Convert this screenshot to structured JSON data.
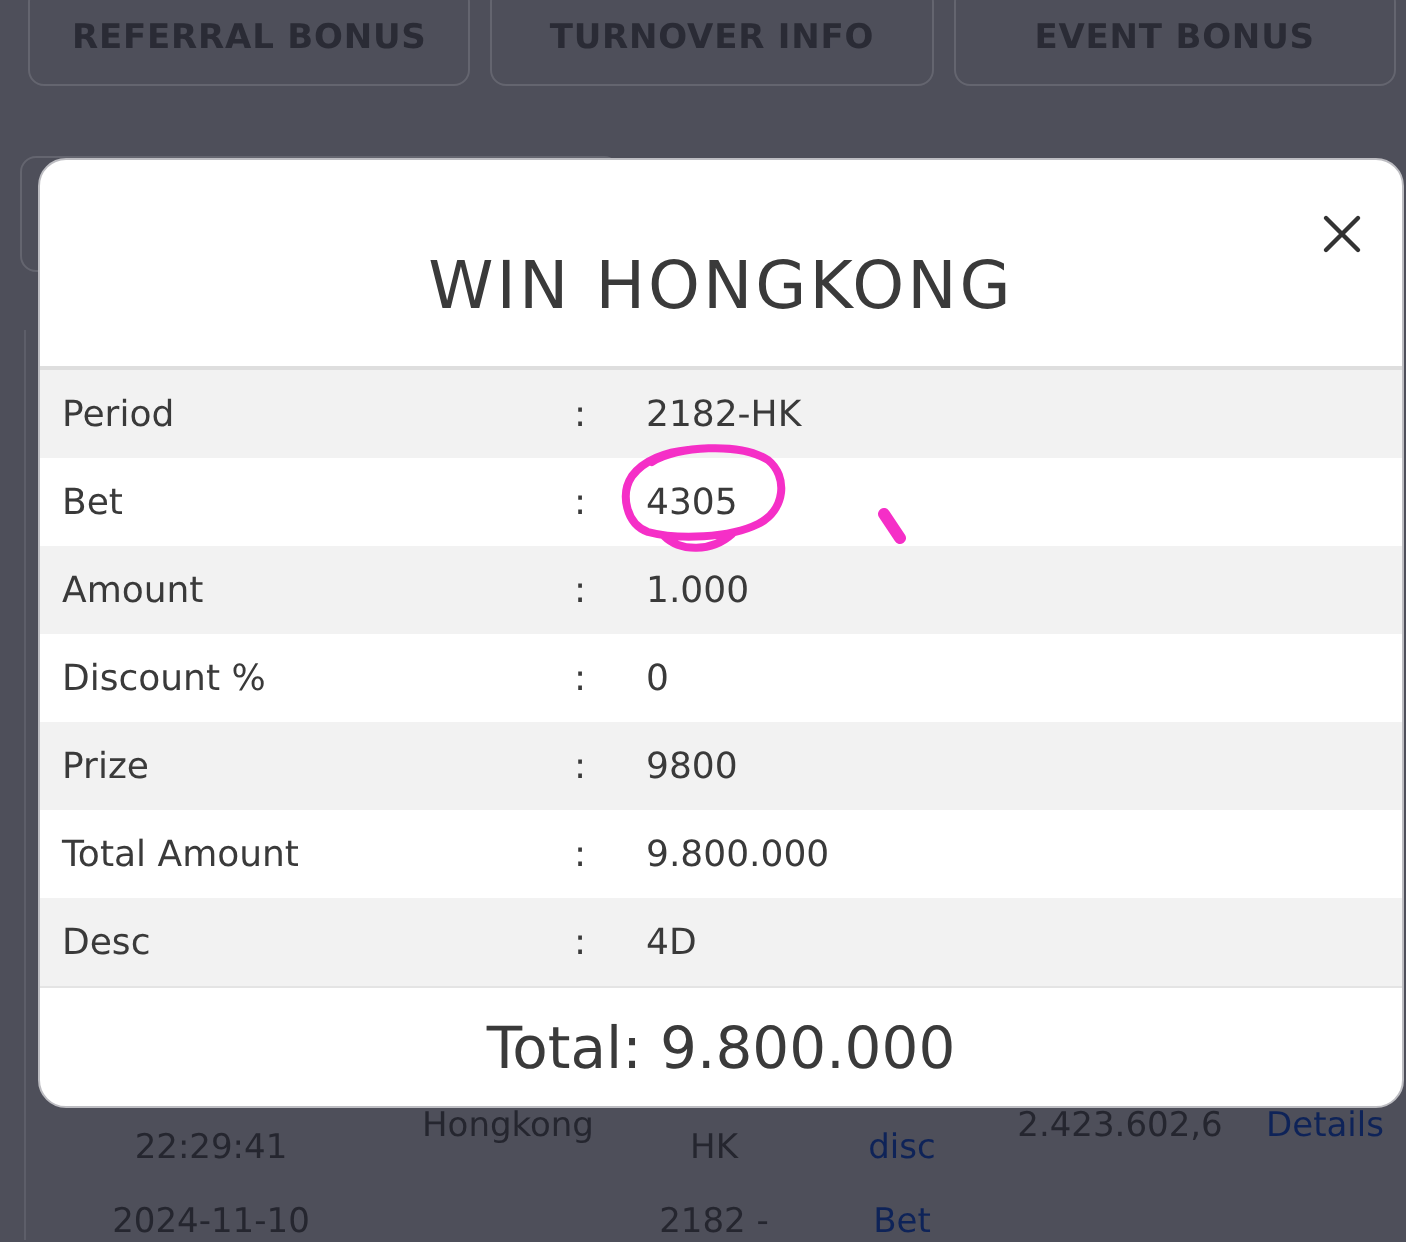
{
  "bonus_buttons": [
    {
      "label": "REFERRAL BONUS"
    },
    {
      "label": "TURNOVER INFO"
    },
    {
      "label": "EVENT BONUS"
    }
  ],
  "history_table": {
    "rows": [
      {
        "column_1": {
          "text": "22:29:41",
          "kind": "text",
          "first_line_covered": true
        },
        "column_2": {
          "text": "Hongkong",
          "kind": "text",
          "first_line_covered": false
        },
        "column_3": {
          "text": "HK",
          "kind": "text",
          "first_line_covered": true
        },
        "column_4": {
          "text": "disc",
          "kind": "link",
          "first_line_covered": true
        },
        "column_5": {
          "text": "2.423.602,6",
          "kind": "text",
          "first_line_covered": false
        },
        "column_6": {
          "text": "Details",
          "kind": "link",
          "first_line_covered": false
        }
      },
      {
        "column_1": {
          "text": "2024-11-10",
          "kind": "text"
        },
        "column_3": {
          "text": "2182 -",
          "kind": "text"
        },
        "column_4": {
          "text": "Bet",
          "kind": "link"
        }
      }
    ]
  },
  "modal": {
    "title": "WIN HONGKONG",
    "rows": [
      {
        "label": "Period",
        "separator": ":",
        "value": "2182-HK",
        "circled": false
      },
      {
        "label": "Bet",
        "separator": ":",
        "value": "4305",
        "circled": true
      },
      {
        "label": "Amount",
        "separator": ":",
        "value": "1.000",
        "circled": false
      },
      {
        "label": "Discount %",
        "separator": ":",
        "value": "0",
        "circled": false
      },
      {
        "label": "Prize",
        "separator": ":",
        "value": "9800",
        "circled": false
      },
      {
        "label": "Total Amount",
        "separator": ":",
        "value": "9.800.000",
        "circled": false
      },
      {
        "label": "Desc",
        "separator": ":",
        "value": "4D",
        "circled": false
      }
    ],
    "total": "Total: 9.800.000",
    "pen_stroke": true
  }
}
